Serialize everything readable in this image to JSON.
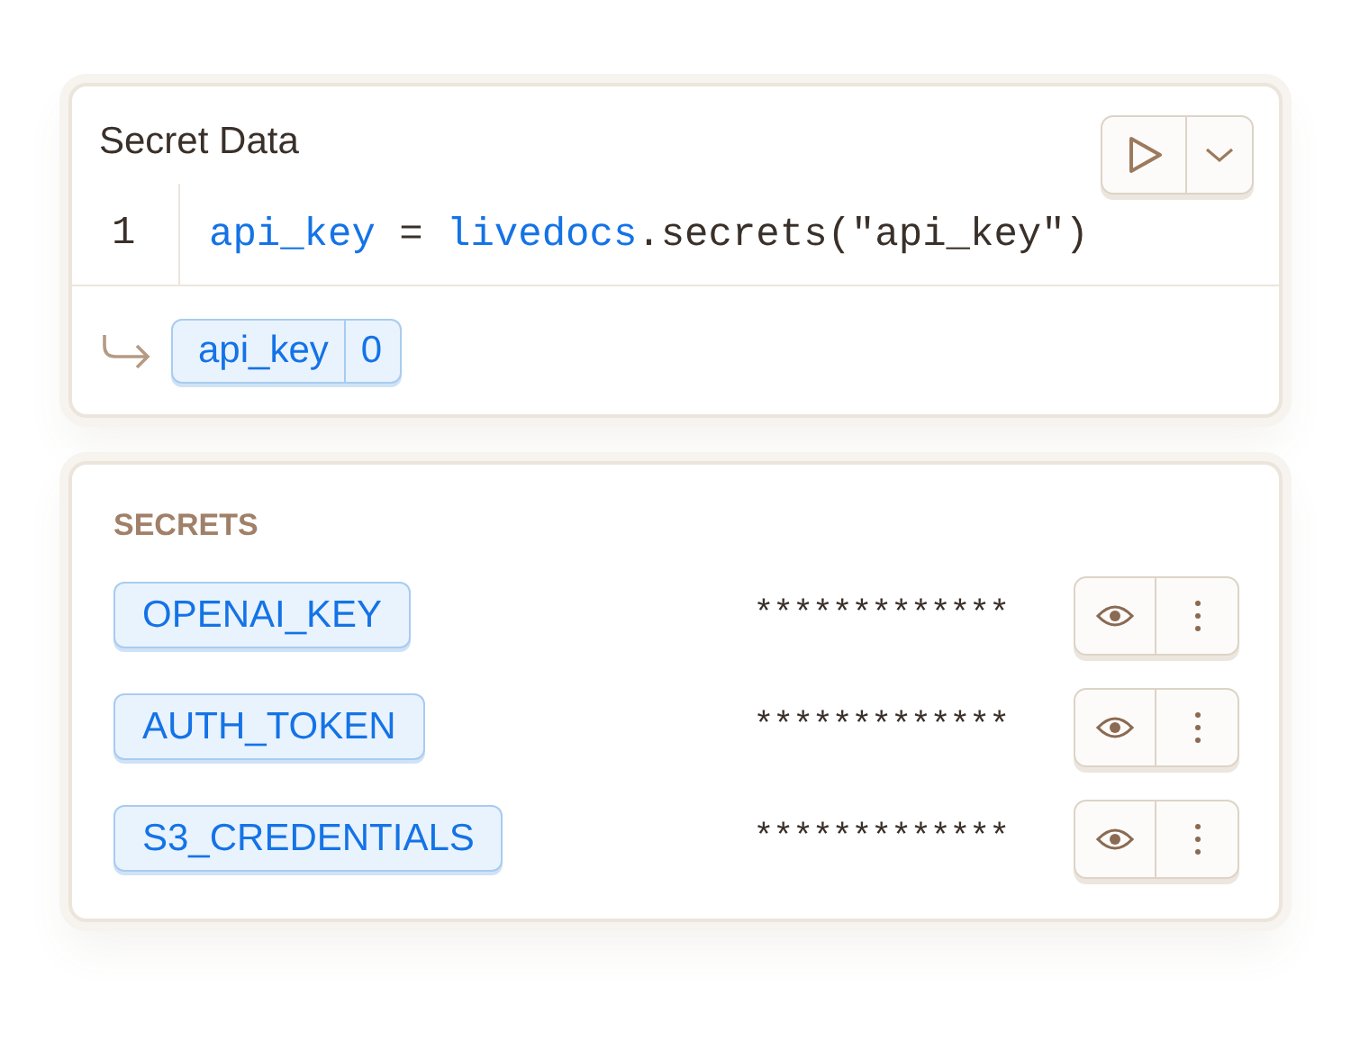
{
  "cell": {
    "title": "Secret Data",
    "code_lines": [
      {
        "number": "1",
        "tokens": [
          {
            "text": "api_key",
            "kind": "variable"
          },
          {
            "text": " = ",
            "kind": "plain"
          },
          {
            "text": "livedocs",
            "kind": "variable"
          },
          {
            "text": ".secrets(\"api_key\")",
            "kind": "plain"
          }
        ]
      }
    ],
    "output": {
      "name": "api_key",
      "value": "0"
    }
  },
  "secrets_panel": {
    "heading": "SECRETS",
    "secrets": [
      {
        "name": "OPENAI_KEY",
        "masked_value": "*************"
      },
      {
        "name": "AUTH_TOKEN",
        "masked_value": "*************"
      },
      {
        "name": "S3_CREDENTIALS",
        "masked_value": "*************"
      }
    ]
  }
}
